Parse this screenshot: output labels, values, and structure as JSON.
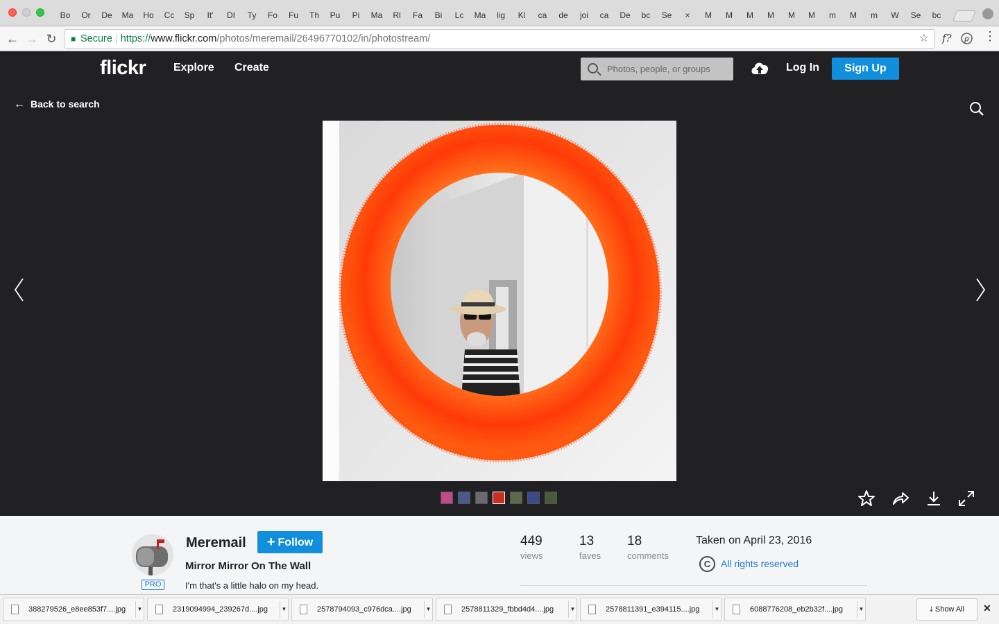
{
  "browser": {
    "tabs": [
      "Bo",
      "Or",
      "De",
      "Ma",
      "Ho",
      "Cc",
      "Sp",
      "It'",
      "DI",
      "Ty",
      "Fo",
      "Fu",
      "Th",
      "Pu",
      "Pi",
      "Ma",
      "Rl",
      "Fa",
      "Bi",
      "Lc",
      "Ma",
      "lig",
      "Kl",
      "ca",
      "de",
      "joi",
      "ca",
      "De",
      "bc",
      "Se",
      "×",
      "M",
      "M",
      "M",
      "M",
      "M",
      "M",
      "m",
      "M",
      "m",
      "W",
      "Se",
      "bc"
    ],
    "active_tab_index": 30,
    "url": {
      "secure_label": "Secure",
      "protocol": "https://",
      "host": "www.flickr.com",
      "path": "/photos/meremail/26496770102/in/photostream/"
    },
    "extensions": [
      "f?",
      "pinterest-icon",
      "more-icon"
    ]
  },
  "flickr": {
    "logo": "flickr",
    "nav_explore": "Explore",
    "nav_create": "Create",
    "search_placeholder": "Photos, people, or groups",
    "login": "Log In",
    "signup": "Sign Up",
    "back_label": "Back to search",
    "accent_color": "#128fdc"
  },
  "photo": {
    "owner": "Meremail",
    "pro_badge": "PRO",
    "follow_label": "Follow",
    "title": "Mirror Mirror On The Wall",
    "description": "I'm that's a little halo on my head.",
    "views": "449",
    "views_label": "views",
    "faves": "13",
    "faves_label": "faves",
    "comments": "18",
    "comments_label": "comments",
    "taken": "Taken on April 23, 2016",
    "rights": "All rights reserved",
    "thumbnails": 7
  },
  "downloads": {
    "items": [
      "388279526_e8ee853f7....jpg",
      "2319094994_239267d....jpg",
      "2578794093_c976dca....jpg",
      "2578811329_fbbd4d4....jpg",
      "2578811391_e394115....jpg",
      "6088776208_eb2b32f....jpg"
    ],
    "show_all": "Show All"
  }
}
